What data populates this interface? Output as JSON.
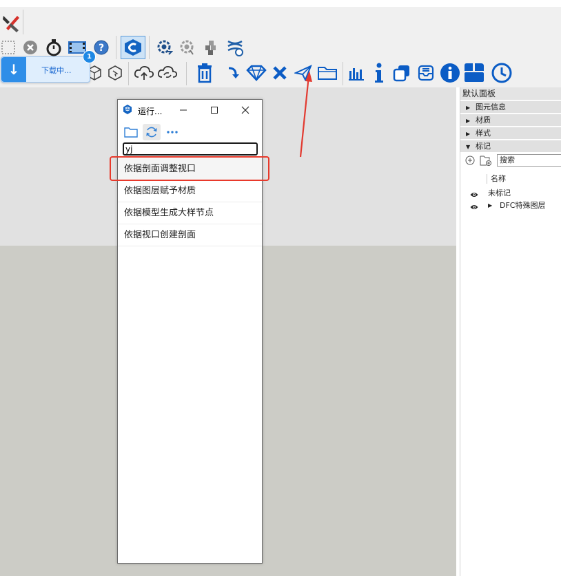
{
  "toast": {
    "text": "下载中...",
    "badge": "1"
  },
  "run_window": {
    "title": "运行...",
    "search_value": "yj",
    "items": [
      "依据剖面调整视口",
      "依据图层赋予材质",
      "依据模型生成大样节点",
      "依据视口创建剖面"
    ]
  },
  "right_panel": {
    "title": "默认面板",
    "sections": [
      "图元信息",
      "材质",
      "样式",
      "标记"
    ],
    "tags_search_placeholder": "搜索",
    "column_header": "名称",
    "rows": [
      "未标记",
      "DFC特殊图层"
    ]
  },
  "colors": {
    "accent": "#0b5cc5",
    "highlight": "#e8392b",
    "toast_bg": "#dfeefd"
  }
}
